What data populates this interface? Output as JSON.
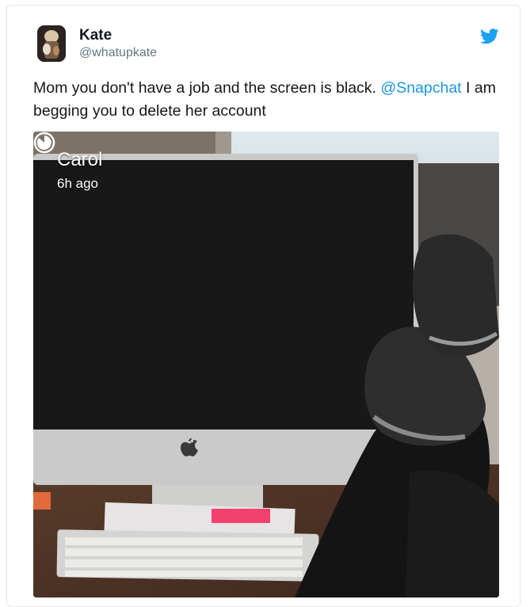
{
  "tweet": {
    "author_name": "Kate",
    "author_handle": "@whatupkate",
    "text_before": "Mom you don't have a job and the screen is black. ",
    "mention": "@Snapchat",
    "text_after": " I am begging you to delete her account",
    "brand_icon": "twitter-bird-icon",
    "accent_color": "#1da1f2",
    "mention_color": "#1b95e0"
  },
  "snap": {
    "sender": "Carol",
    "time_ago": "6h ago",
    "timer_icon": "snap-timer-icon"
  }
}
